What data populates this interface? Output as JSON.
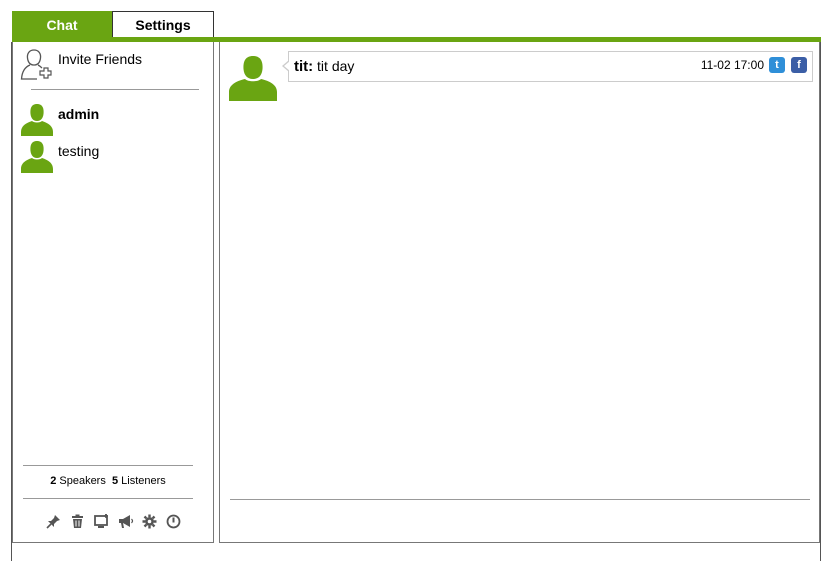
{
  "tabs": [
    {
      "label": "Chat",
      "active": true
    },
    {
      "label": "Settings",
      "active": false
    }
  ],
  "sidebar": {
    "invite_label": "Invite Friends",
    "users": [
      {
        "name": "admin",
        "bold": true
      },
      {
        "name": "testing",
        "bold": false
      }
    ],
    "speakers_count": "2",
    "speakers_label": "Speakers",
    "listeners_count": "5",
    "listeners_label": "Listeners",
    "toolbar_icons": [
      "pin-icon",
      "trash-icon",
      "screen-share-icon",
      "megaphone-icon",
      "gear-icon",
      "power-icon"
    ]
  },
  "messages": [
    {
      "author": "tit:",
      "text": "tit day",
      "time": "11-02 17:00"
    }
  ],
  "colors": {
    "accent": "#6aa512",
    "twitter": "#2f8fd8",
    "facebook": "#3b5ea6"
  }
}
